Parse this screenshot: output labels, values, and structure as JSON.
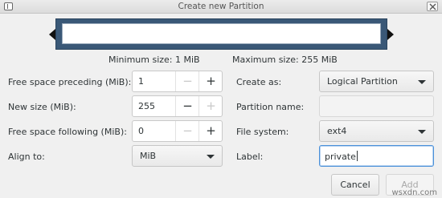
{
  "window": {
    "title": "Create new Partition"
  },
  "partition_graphic": {},
  "size_info": {
    "minimum": "Minimum size: 1 MiB",
    "maximum": "Maximum size: 255 MiB"
  },
  "left_form": {
    "free_preceding": {
      "label": "Free space preceding (MiB):",
      "value": "1"
    },
    "new_size": {
      "label": "New size (MiB):",
      "value": "255"
    },
    "free_following": {
      "label": "Free space following (MiB):",
      "value": "0"
    },
    "align_to": {
      "label": "Align to:",
      "selected": "MiB"
    }
  },
  "right_form": {
    "create_as": {
      "label": "Create as:",
      "selected": "Logical Partition"
    },
    "partition_name": {
      "label": "Partition name:",
      "value": ""
    },
    "file_system": {
      "label": "File system:",
      "selected": "ext4"
    },
    "label_field": {
      "label": "Label:",
      "value": "private"
    }
  },
  "buttons": {
    "cancel": "Cancel",
    "add": "Add"
  },
  "spin_symbols": {
    "minus": "−",
    "plus": "+"
  },
  "watermark": "wsxdn.com",
  "colors": {
    "partition_fill": "#3a5877",
    "focus_ring": "#4a90d9"
  }
}
